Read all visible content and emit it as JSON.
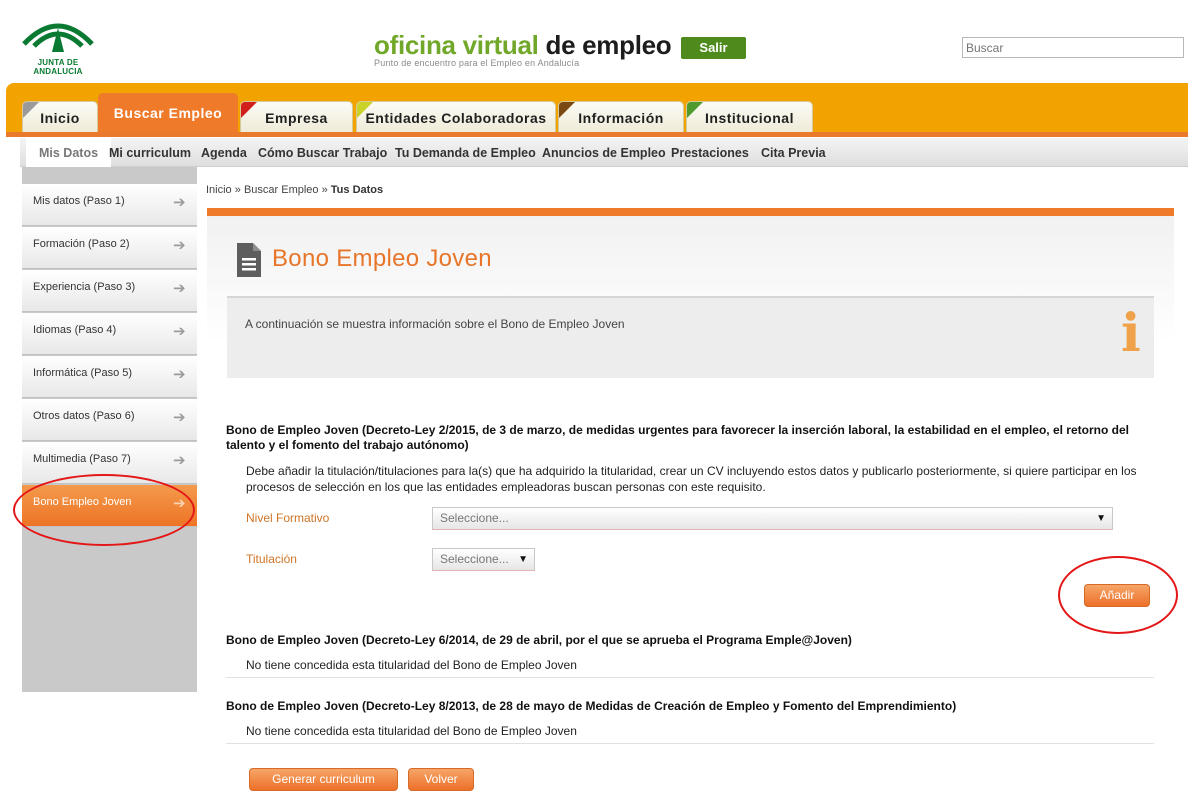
{
  "header": {
    "logo_text": "JUNTA DE ANDALUCIA",
    "brand_green": "oficina virtual",
    "brand_dark": "de empleo",
    "brand_subtitle": "Punto de encuentro para el Empleo en Andalucía",
    "salir_label": "Salir",
    "search_placeholder": "Buscar"
  },
  "tabs": [
    {
      "label": "Inicio",
      "corner_color": "#9a9a9a"
    },
    {
      "label": "Buscar Empleo",
      "corner_color": "#ee7a2a"
    },
    {
      "label": "Empresa",
      "corner_color": "#d1201b"
    },
    {
      "label": "Entidades Colaboradoras",
      "corner_color": "#c9d32a"
    },
    {
      "label": "Información",
      "corner_color": "#7a4a12"
    },
    {
      "label": "Institucional",
      "corner_color": "#4f9a2c"
    }
  ],
  "subnav": [
    "Mis Datos",
    "Mi curriculum",
    "Agenda",
    "Cómo Buscar Trabajo",
    "Tu Demanda de Empleo",
    "Anuncios de Empleo",
    "Prestaciones",
    "Cita Previa"
  ],
  "sidebar": [
    "Mis datos (Paso 1)",
    "Formación (Paso 2)",
    "Experiencia (Paso 3)",
    "Idiomas (Paso 4)",
    "Informática (Paso 5)",
    "Otros datos (Paso 6)",
    "Multimedia (Paso 7)",
    "Bono Empleo Joven"
  ],
  "breadcrumb": {
    "home": "Inicio",
    "sep": "»",
    "section": "Buscar Empleo",
    "current": "Tus Datos"
  },
  "page_title": "Bono Empleo Joven",
  "info_text": "A continuación se muestra información sobre el Bono de Empleo Joven",
  "section1": {
    "title": "Bono de Empleo Joven (Decreto-Ley 2/2015, de 3 de marzo, de medidas urgentes para favorecer la inserción laboral, la estabilidad en el empleo, el retorno del talento y el fomento del trabajo autónomo)",
    "description": "Debe añadir la titulación/titulaciones para la(s) que ha adquirido la titularidad, crear un CV incluyendo estos datos y publicarlo posteriormente, si quiere participar en los procesos de selección en los que las entidades empleadoras buscan personas con este requisito.",
    "nivel_label": "Nivel Formativo",
    "nivel_value": "Seleccione...",
    "titulacion_label": "Titulación",
    "titulacion_value": "Seleccione...",
    "add_label": "Añadir"
  },
  "section2": {
    "title": "Bono de Empleo Joven (Decreto-Ley 6/2014, de 29 de abril, por el que se aprueba el Programa Emple@Joven)",
    "status": "No tiene concedida esta titularidad del Bono de Empleo Joven"
  },
  "section3": {
    "title": "Bono de Empleo Joven (Decreto-Ley 8/2013, de 28 de mayo de Medidas de Creación de Empleo y Fomento del Emprendimiento)",
    "status": "No tiene concedida esta titularidad del Bono de Empleo Joven"
  },
  "footer_buttons": {
    "generate": "Generar curriculum",
    "back": "Volver"
  },
  "colors": {
    "accent": "#ee7a2a",
    "brand_green": "#72a82a",
    "band": "#f3a300",
    "highlight": "#e31717"
  }
}
